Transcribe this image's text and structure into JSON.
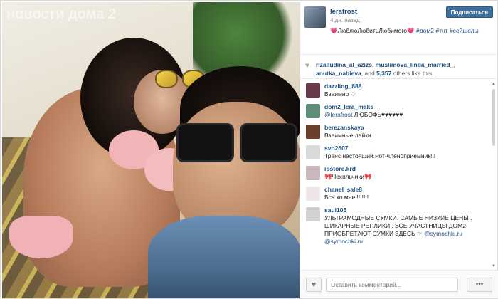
{
  "photo": {
    "watermark": "новости дома 2"
  },
  "post": {
    "username": "lerafrost",
    "time": "4 дн. назад",
    "follow_button": "Подписаться",
    "caption_text": "💗ЛюблюЛюбитьЛюбимого💗 ",
    "hashtags": [
      "#дом2",
      "#тнт",
      "#сейшелы"
    ]
  },
  "likes": {
    "users": [
      "rizalludina_al_azizs",
      "muslimova_linda_married_",
      "anutka_nabieva"
    ],
    "and": "and",
    "count": "5,357",
    "suffix": "others like this."
  },
  "comments": [
    {
      "user": "dazzling_888",
      "text": "Взаимно ♡",
      "avatar_color": "#6b3b4b"
    },
    {
      "user": "dom2_lera_maks",
      "text_prefix": "",
      "mention": "@lerafrost",
      "text": " ЛЮБОФЬ♥♥♥♥♥♥",
      "avatar_color": "#5e8f7a"
    },
    {
      "user": "berezanskaya__",
      "text": "Взаимные лайки",
      "avatar_color": "#6a3f2c"
    },
    {
      "user": "svo2607",
      "text": "Транс настоящий.Рот-членоприемник!!!",
      "avatar_color": "#d9d9d9"
    },
    {
      "user": "ipstore.krd",
      "text": "🎀Чехольчики🎀",
      "avatar_color": "#c8b7bf"
    },
    {
      "user": "chanel_sale8",
      "text": "Все ко мне !!!!!!!",
      "avatar_color": "#ece6e6"
    },
    {
      "user": "saul105",
      "text": "УЛЬТРАМОДНЫЕ СУМКИ. САМЫЕ НИЗКИЕ ЦЕНЫ . ШИКАРНЫЕ РЕПЛИКИ . ВСЕ УЧАСТНИЦЫ ДОМ2 ПРИОБРЕТАЮТ СУМКИ ЗДЕСЬ ☞ ",
      "mention": "@symochki.ru",
      "mention2": "@symochki.ru",
      "avatar_color": "#d2d2d2"
    }
  ],
  "footer": {
    "comment_placeholder": "Оставить комментарий...",
    "like_icon": "heart-icon",
    "more_label": "•••"
  }
}
